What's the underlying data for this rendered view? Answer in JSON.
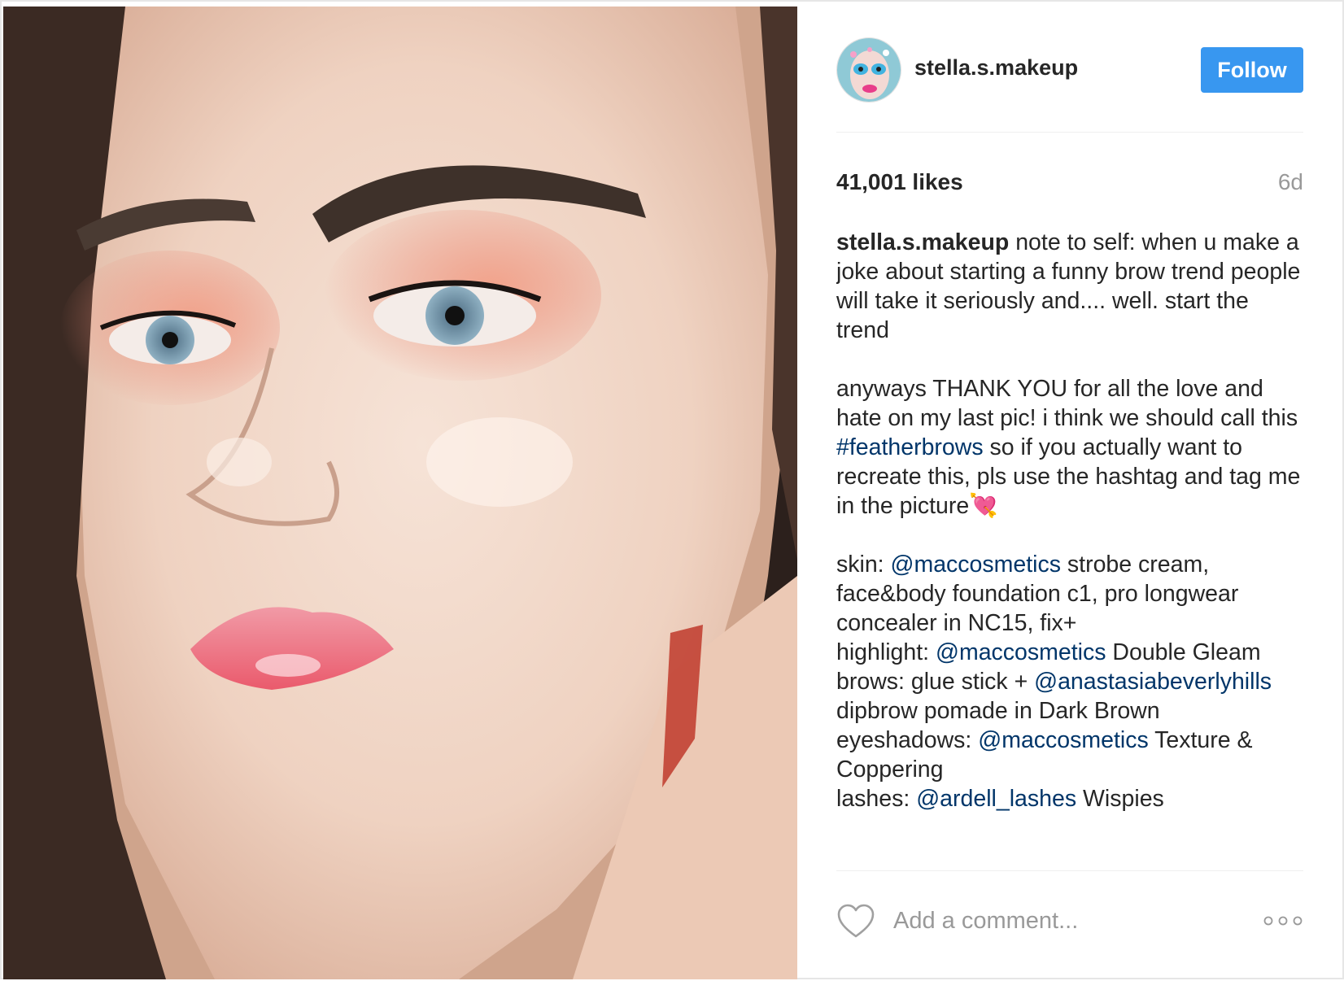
{
  "post": {
    "username": "stella.s.makeup",
    "follow_label": "Follow",
    "likes": "41,001 likes",
    "time": "6d",
    "caption_lines": [
      {
        "parts": [
          {
            "t": "user",
            "v": "stella.s.makeup"
          },
          {
            "t": "text",
            "v": " note to self: when u make a joke about starting a funny brow trend people will take it seriously and.... well. start the trend"
          }
        ]
      },
      {
        "parts": []
      },
      {
        "parts": [
          {
            "t": "text",
            "v": "anyways THANK YOU for all the love and hate on my last pic! i think we should call this "
          },
          {
            "t": "link",
            "v": "#featherbrows"
          },
          {
            "t": "text",
            "v": " so if you actually want to recreate this, pls use the hashtag and tag me in the picture"
          },
          {
            "t": "emoji",
            "v": "💘"
          }
        ]
      },
      {
        "parts": []
      },
      {
        "parts": [
          {
            "t": "text",
            "v": "skin: "
          },
          {
            "t": "link",
            "v": "@maccosmetics"
          },
          {
            "t": "text",
            "v": " strobe cream, face&body foundation c1, pro longwear concealer in NC15, fix+"
          }
        ]
      },
      {
        "parts": [
          {
            "t": "text",
            "v": "highlight: "
          },
          {
            "t": "link",
            "v": "@maccosmetics"
          },
          {
            "t": "text",
            "v": " Double Gleam"
          }
        ]
      },
      {
        "parts": [
          {
            "t": "text",
            "v": "brows: glue stick + "
          },
          {
            "t": "link",
            "v": "@anastasiabeverlyhills"
          },
          {
            "t": "text",
            "v": " dipbrow pomade in Dark Brown"
          }
        ]
      },
      {
        "parts": [
          {
            "t": "text",
            "v": "eyeshadows: "
          },
          {
            "t": "link",
            "v": "@maccosmetics"
          },
          {
            "t": "text",
            "v": " Texture & Coppering"
          }
        ]
      },
      {
        "parts": [
          {
            "t": "text",
            "v": "lashes: "
          },
          {
            "t": "link",
            "v": "@ardell_lashes"
          },
          {
            "t": "text",
            "v": " Wispies"
          }
        ]
      }
    ],
    "comment_placeholder": "Add a comment...",
    "icons": {
      "like": "heart-outline-icon",
      "more": "more-options-icon"
    },
    "colors": {
      "follow": "#3897f0",
      "link": "#003569",
      "muted": "#999999"
    }
  }
}
